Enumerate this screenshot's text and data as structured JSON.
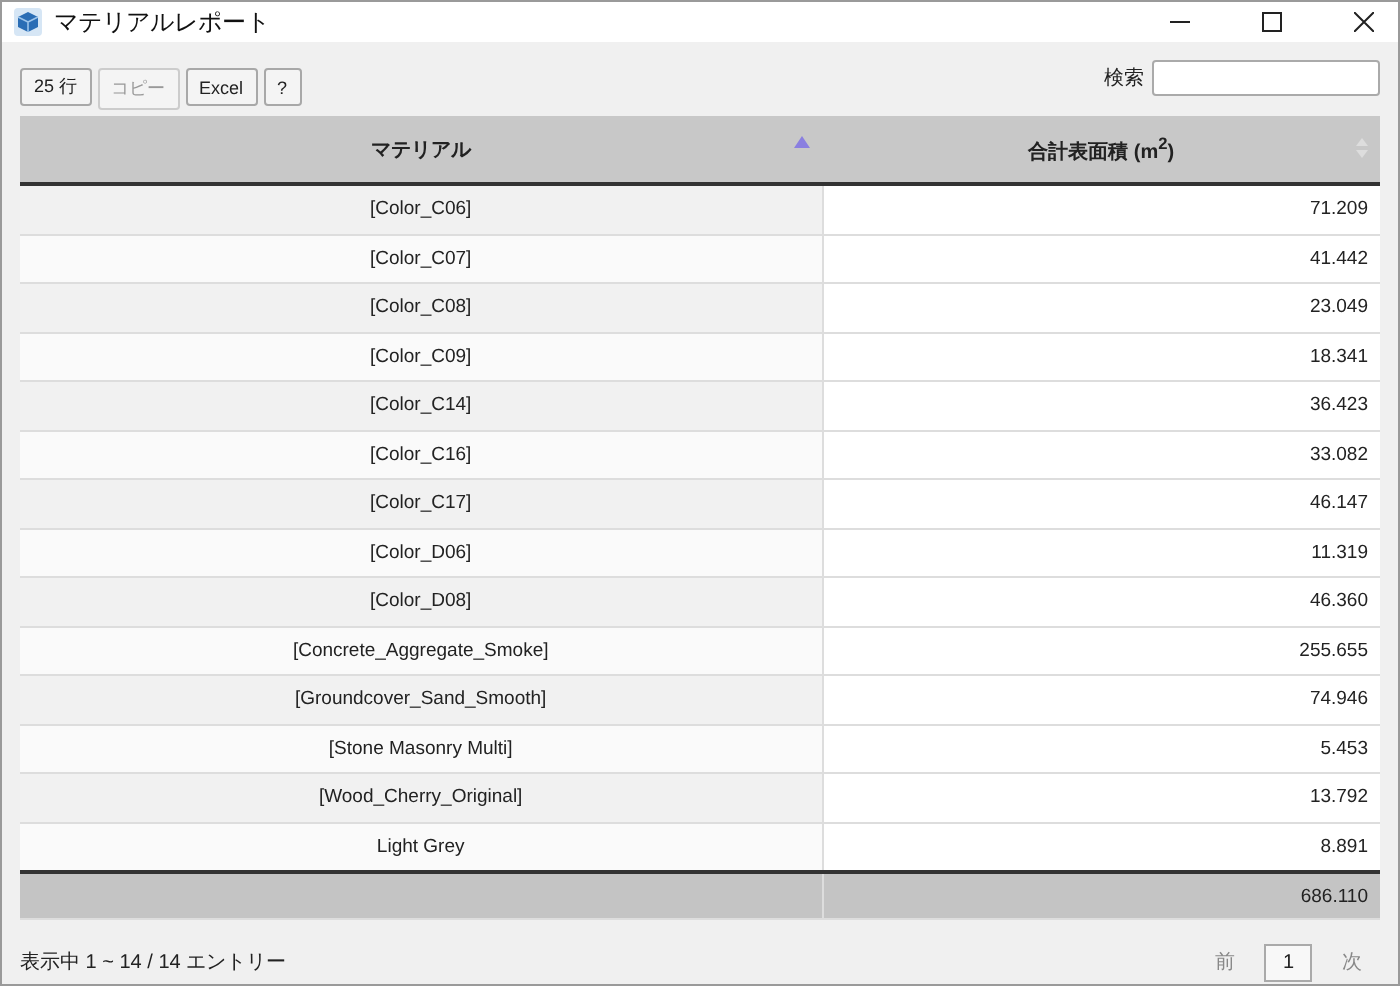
{
  "window": {
    "title": "マテリアルレポート"
  },
  "toolbar": {
    "buttons": [
      {
        "label": "25 行",
        "disabled": false
      },
      {
        "label": "コピー",
        "disabled": true
      },
      {
        "label": "Excel",
        "disabled": false
      },
      {
        "label": "?",
        "disabled": false
      }
    ],
    "search": {
      "label": "検索"
    }
  },
  "table": {
    "columns": [
      {
        "label": "マテリアル",
        "sorted": true
      },
      {
        "label": "合計表面積 (m$^{2}$)",
        "sorted": false
      }
    ],
    "rows": [
      [
        "[Color_C06]",
        "71.209"
      ],
      [
        "[Color_C07]",
        "41.442"
      ],
      [
        "[Color_C08]",
        "23.049"
      ],
      [
        "[Color_C09]",
        "18.341"
      ],
      [
        "[Color_C14]",
        "36.423"
      ],
      [
        "[Color_C16]",
        "33.082"
      ],
      [
        "[Color_C17]",
        "46.147"
      ],
      [
        "[Color_D06]",
        "11.319"
      ],
      [
        "[Color_D08]",
        "46.360"
      ],
      [
        "[Concrete_Aggregate_Smoke]",
        "255.655"
      ],
      [
        "[Groundcover_Sand_Smooth]",
        "74.946"
      ],
      [
        "[Stone Masonry Multi]",
        "5.453"
      ],
      [
        "[Wood_Cherry_Original]",
        "13.792"
      ],
      [
        "Light Grey",
        "8.891"
      ]
    ],
    "total": "686.110"
  },
  "status": "表示中 1 ~ 14 / 14 エントリー",
  "pagination": [
    {
      "label": "前",
      "disabled": true,
      "selected": false
    },
    {
      "label": "1",
      "disabled": false,
      "selected": true
    },
    {
      "label": "次",
      "disabled": true,
      "selected": false
    }
  ]
}
